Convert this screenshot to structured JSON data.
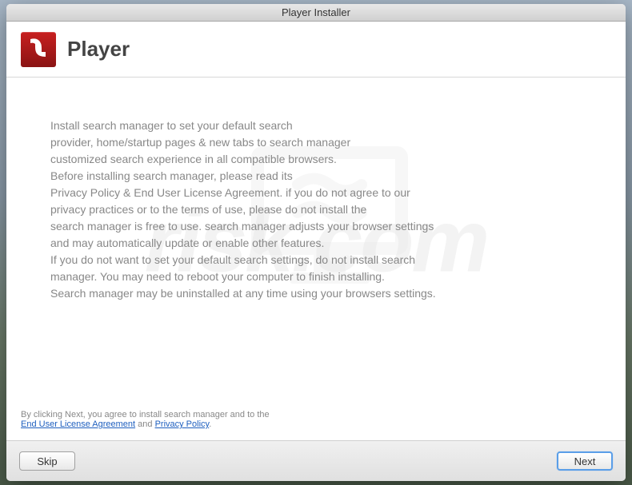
{
  "window": {
    "title": "Player Installer"
  },
  "header": {
    "title": "Player"
  },
  "body": {
    "line1": "Install search manager to set your default search",
    "line2": "provider, home/startup pages & new tabs to search manager",
    "line3": "customized search experience in all compatible browsers.",
    "line4": "Before installing search manager, please read its",
    "line5": "Privacy Policy & End User License Agreement. if you do not agree to our",
    "line6": "privacy practices or to the terms of use, please do not install the",
    "line7": "search manager is free to use. search manager adjusts your browser settings",
    "line8": "and may automatically update or enable other features.",
    "line9": "If you do not want to set your default search settings, do not install search",
    "line10": "manager. You may need to reboot your computer to finish installing.",
    "line11": "Search manager may be uninstalled at any time using your browsers settings."
  },
  "footer": {
    "prefix": "By clicking Next, you agree to install search manager and to the",
    "eula": "End User License Agreement",
    "and": " and ",
    "privacy": "Privacy Policy",
    "suffix": "."
  },
  "buttons": {
    "skip": "Skip",
    "next": "Next"
  },
  "watermark": "risk.com"
}
